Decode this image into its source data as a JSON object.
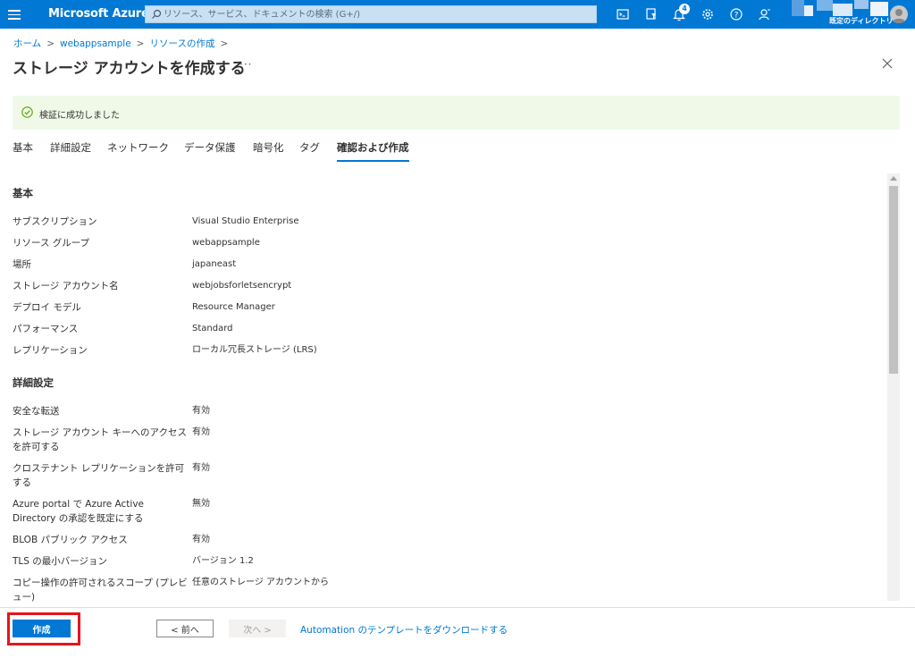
{
  "topbar": {
    "brand": "Microsoft Azure",
    "search_placeholder": "リソース、サービス、ドキュメントの検索 (G+/)",
    "notification_count": "4",
    "directory": "既定のディレクトリ",
    "icons": [
      "hamburger-menu-icon",
      "search-icon",
      "cloud-shell-icon",
      "directory-filter-icon",
      "notifications-icon",
      "settings-icon",
      "help-icon",
      "feedback-icon",
      "avatar"
    ]
  },
  "breadcrumb": {
    "items": [
      "ホーム",
      "webappsample",
      "リソースの作成"
    ]
  },
  "page": {
    "title": "ストレージ アカウントを作成する",
    "more": "···"
  },
  "banner": {
    "text": "検証に成功しました"
  },
  "tabs": [
    {
      "label": "基本"
    },
    {
      "label": "詳細設定"
    },
    {
      "label": "ネットワーク"
    },
    {
      "label": "データ保護"
    },
    {
      "label": "暗号化"
    },
    {
      "label": "タグ"
    },
    {
      "label": "確認および作成"
    }
  ],
  "active_tab": "確認および作成",
  "sections": {
    "basic": {
      "heading": "基本",
      "rows": [
        {
          "label": "サブスクリプション",
          "value": "Visual Studio Enterprise"
        },
        {
          "label": "リソース グループ",
          "value": "webappsample"
        },
        {
          "label": "場所",
          "value": "japaneast"
        },
        {
          "label": "ストレージ アカウント名",
          "value": "webjobsforletsencrypt"
        },
        {
          "label": "デプロイ モデル",
          "value": "Resource Manager"
        },
        {
          "label": "パフォーマンス",
          "value": "Standard"
        },
        {
          "label": "レプリケーション",
          "value": "ローカル冗長ストレージ (LRS)"
        }
      ]
    },
    "advanced": {
      "heading": "詳細設定",
      "rows": [
        {
          "label": "安全な転送",
          "value": "有効"
        },
        {
          "label": "ストレージ アカウント キーへのアクセスを許可する",
          "value": "有効"
        },
        {
          "label": "クロステナント レプリケーションを許可する",
          "value": "有効"
        },
        {
          "label": "Azure portal で Azure Active Directory の承認を既定にする",
          "value": "無効"
        },
        {
          "label": "BLOB パブリック アクセス",
          "value": "有効"
        },
        {
          "label": "TLS の最小バージョン",
          "value": "バージョン 1.2"
        },
        {
          "label": "コピー操作の許可されるスコープ (プレビュー)",
          "value": "任意のストレージ アカウントから"
        }
      ]
    }
  },
  "footer": {
    "create_label": "作成",
    "prev_label": "< 前へ",
    "next_label": "次へ >",
    "download_link": "Automation のテンプレートをダウンロードする"
  },
  "colors": {
    "accent": "#0078d4",
    "banner_bg": "#f0f9e8",
    "success": "#57a300",
    "highlight": "#e8141b"
  }
}
